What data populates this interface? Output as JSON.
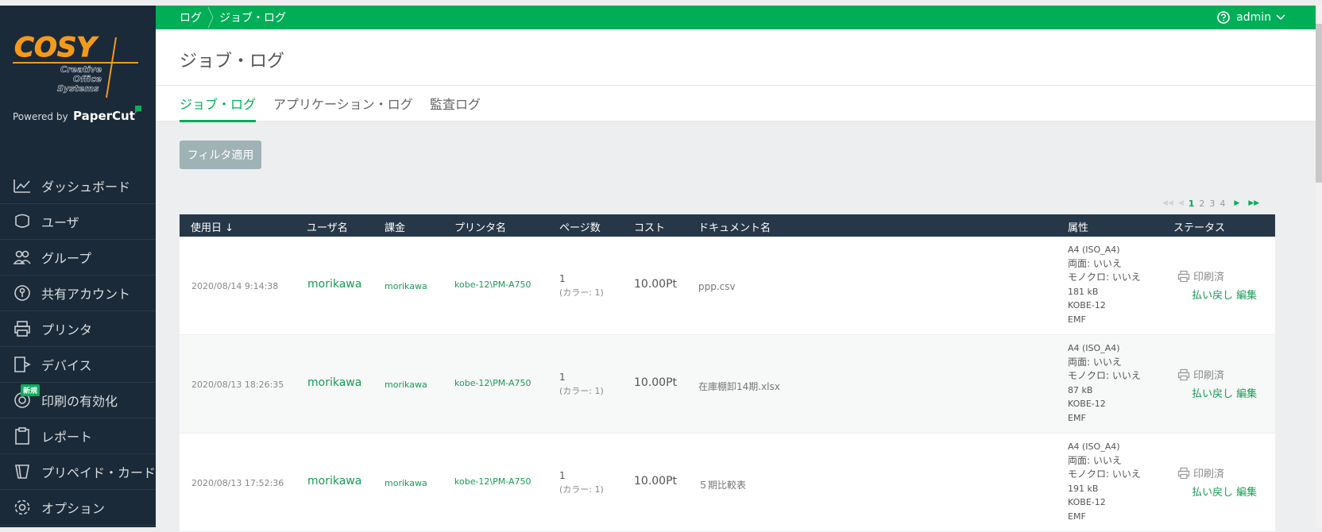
{
  "breadcrumb": {
    "root": "ログ",
    "current": "ジョブ・ログ"
  },
  "user": {
    "name": "admin"
  },
  "page": {
    "title": "ジョブ・ログ"
  },
  "tabs": [
    "ジョブ・ログ",
    "アプリケーション・ログ",
    "監査ログ"
  ],
  "filter_button": "フィルタ適用",
  "logo": {
    "brand": "COSY",
    "line1": "Creative",
    "line2": "Office",
    "line3": "Systems",
    "powered": "Powered by",
    "papercut": "PaperCut"
  },
  "sidebar": {
    "items": [
      {
        "label": "ダッシュボード",
        "icon": "dashboard-icon"
      },
      {
        "label": "ユーザ",
        "icon": "user-icon"
      },
      {
        "label": "グループ",
        "icon": "group-icon"
      },
      {
        "label": "共有アカウント",
        "icon": "shared-account-icon"
      },
      {
        "label": "プリンタ",
        "icon": "printer-icon"
      },
      {
        "label": "デバイス",
        "icon": "device-icon"
      },
      {
        "label": "印刷の有効化",
        "icon": "print-release-icon",
        "badge": "新規"
      },
      {
        "label": "レポート",
        "icon": "report-icon"
      },
      {
        "label": "プリペイド・カード",
        "icon": "prepaid-card-icon"
      },
      {
        "label": "オプション",
        "icon": "options-gear-icon"
      }
    ]
  },
  "pager": {
    "pages": [
      "1",
      "2",
      "3",
      "4"
    ],
    "current": "1"
  },
  "table": {
    "headers": [
      "使用日",
      "ユーザ名",
      "課金",
      "プリンタ名",
      "ページ数",
      "コスト",
      "ドキュメント名",
      "属性",
      "ステータス"
    ],
    "sort_arrow": "↓",
    "rows": [
      {
        "date": "2020/08/14 9:14:38",
        "user": "morikawa",
        "account": "morikawa",
        "printer": "kobe-12\\PM-A750",
        "pages": "1",
        "pages_color": "(カラー: 1)",
        "cost": "10.00Pt",
        "document": "ppp.csv",
        "attrs": [
          "A4 (ISO_A4)",
          "両面: いいえ",
          "モノクロ: いいえ",
          "181 kB",
          "KOBE-12",
          "EMF"
        ],
        "status": "印刷済",
        "refund": "払い戻し",
        "edit": "編集"
      },
      {
        "date": "2020/08/13 18:26:35",
        "user": "morikawa",
        "account": "morikawa",
        "printer": "kobe-12\\PM-A750",
        "pages": "1",
        "pages_color": "(カラー: 1)",
        "cost": "10.00Pt",
        "document": "在庫棚卸14期.xlsx",
        "attrs": [
          "A4 (ISO_A4)",
          "両面: いいえ",
          "モノクロ: いいえ",
          "87 kB",
          "KOBE-12",
          "EMF"
        ],
        "status": "印刷済",
        "refund": "払い戻し",
        "edit": "編集"
      },
      {
        "date": "2020/08/13 17:52:36",
        "user": "morikawa",
        "account": "morikawa",
        "printer": "kobe-12\\PM-A750",
        "pages": "1",
        "pages_color": "(カラー: 1)",
        "cost": "10.00Pt",
        "document": "５期比較表",
        "attrs": [
          "A4 (ISO_A4)",
          "両面: いいえ",
          "モノクロ: いいえ",
          "191 kB",
          "KOBE-12",
          "EMF"
        ],
        "status": "印刷済",
        "refund": "払い戻し",
        "edit": "編集"
      }
    ]
  },
  "colors": {
    "accent": "#00ae58",
    "sidebar": "#1b2a38",
    "table_header": "#263848",
    "logo_orange": "#f39a1b"
  }
}
